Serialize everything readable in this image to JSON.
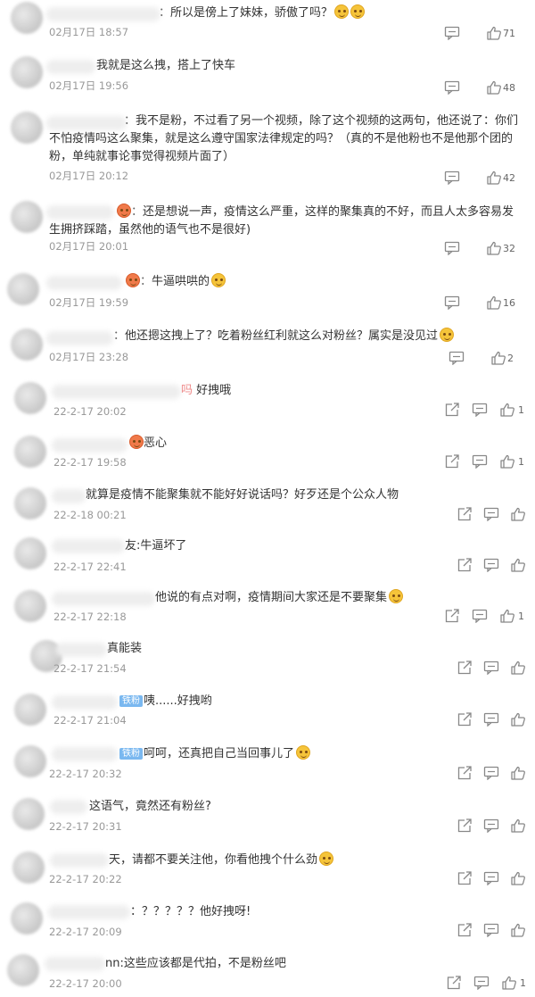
{
  "colors": {
    "background": "#ffffff",
    "text": "#333333",
    "time": "#999999",
    "icon": "#888888",
    "tag": "#7ab8f0"
  },
  "icons": {
    "comment": "comment-icon",
    "like": "thumbs-up-icon",
    "share": "share-icon",
    "emoji": "emoji-icon"
  },
  "comments": [
    {
      "prefix": "：",
      "text": "所以是傍上了妹妹，骄傲了吗？",
      "time": "02月17日 18:57",
      "likes": "71"
    },
    {
      "prefix": "",
      "text": "我就是这么拽，搭上了快车",
      "time": "02月17日 19:56",
      "likes": "48"
    },
    {
      "prefix": "：",
      "text": "我不是粉，不过看了另一个视频，除了这个视频的这两句，他还说了：你们不怕疫情吗这么聚集，就是这么遵守国家法律规定的吗？（真的不是他粉也不是他那个团的粉，单纯就事论事觉得视频片面了）",
      "time": "02月17日 20:12",
      "likes": "42"
    },
    {
      "prefix": "：",
      "text": "还是想说一声，疫情这么严重，这样的聚集真的不好，而且人太多容易发生拥挤踩踏，虽然他的语气也不是很好)",
      "time": "02月17日 20:01",
      "likes": "32"
    },
    {
      "prefix": "：",
      "text": "牛逼哄哄的",
      "time": "02月17日 19:59",
      "likes": "16"
    },
    {
      "prefix": "：",
      "text": "他还摁这拽上了？吃着粉丝红利就这么对粉丝？属实是没见过",
      "time": "02月17日 23:28",
      "likes": "2"
    },
    {
      "prefix": "吗",
      "text": "好拽哦",
      "time": "22-2-17 20:02",
      "likes": "1"
    },
    {
      "prefix": "",
      "text": "恶心",
      "time": "22-2-17 19:58",
      "likes": "1"
    },
    {
      "prefix": "",
      "text": "就算是疫情不能聚集就不能好好说话吗？好歹还是个公众人物",
      "time": "22-2-18 00:21",
      "likes": ""
    },
    {
      "prefix": "",
      "text": "友:牛逼坏了",
      "time": "22-2-17 22:41",
      "likes": ""
    },
    {
      "prefix": "",
      "text": "他说的有点对啊，疫情期间大家还是不要聚集",
      "time": "22-2-17 22:18",
      "likes": "1"
    },
    {
      "prefix": "",
      "text": "真能装",
      "time": "22-2-17 21:54",
      "likes": ""
    },
    {
      "prefix": "",
      "tag": "铁粉",
      "text": "咦......好拽哟",
      "time": "22-2-17 21:04",
      "likes": ""
    },
    {
      "prefix": "",
      "tag": "铁粉",
      "text": "呵呵，还真把自己当回事儿了",
      "time": "22-2-17 20:32",
      "likes": ""
    },
    {
      "prefix": "",
      "text": "这语气，竟然还有粉丝?",
      "time": "22-2-17 20:31",
      "likes": ""
    },
    {
      "prefix": "",
      "text": "天，请都不要关注他，你看他拽个什么劲",
      "time": "22-2-17 20:22",
      "likes": ""
    },
    {
      "prefix": "",
      "text": "：？？？？？他好拽呀!",
      "time": "22-2-17 20:09",
      "likes": ""
    },
    {
      "prefix": "",
      "text": "nn:这些应该都是代拍，不是粉丝吧",
      "time": "22-2-17 20:00",
      "likes": "1"
    }
  ]
}
